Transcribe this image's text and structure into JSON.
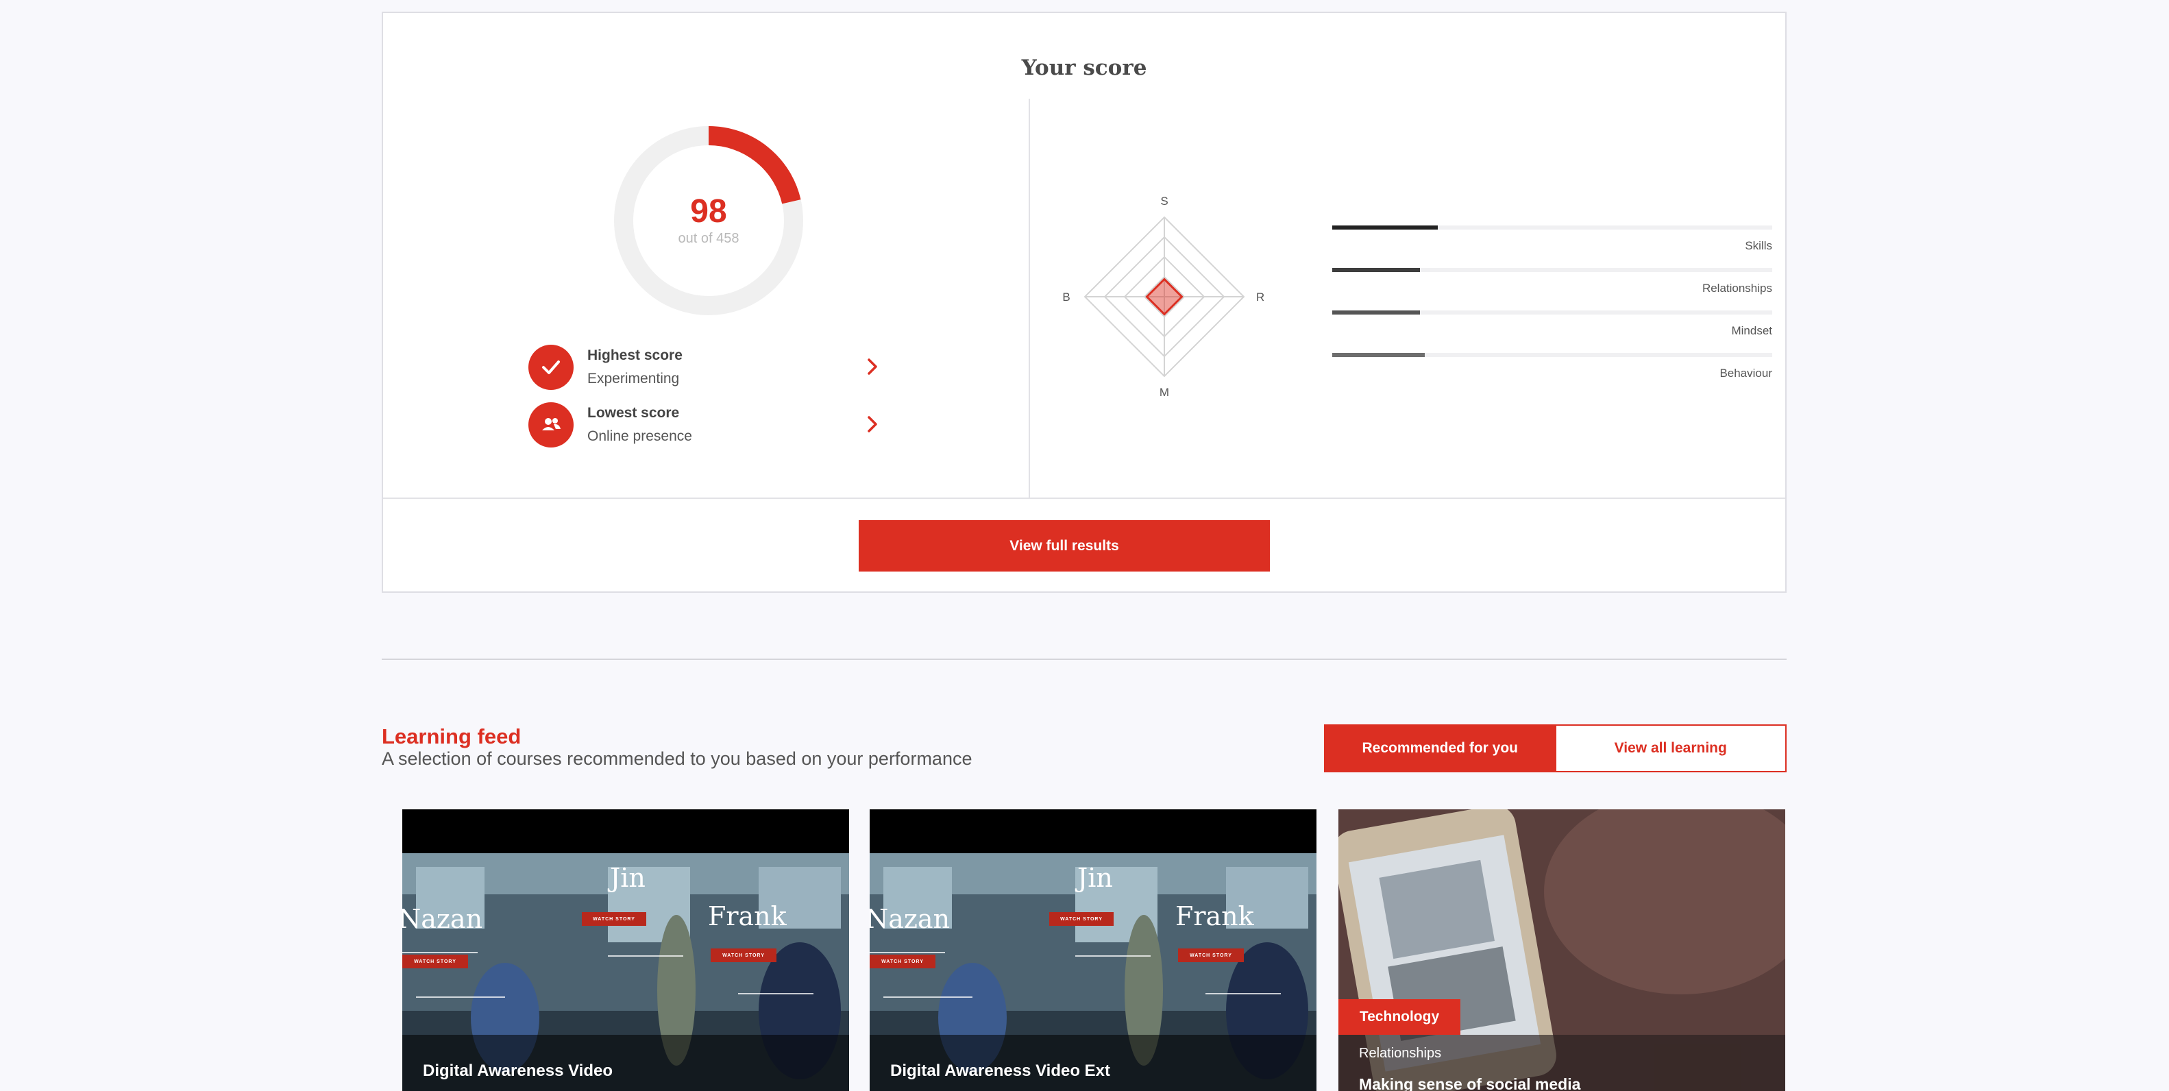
{
  "score": {
    "title": "Your score",
    "value": "98",
    "out_of": "out of 458",
    "fraction": 0.214,
    "highest": {
      "label": "Highest score",
      "value": "Experimenting",
      "icon": "check-icon"
    },
    "lowest": {
      "label": "Lowest score",
      "value": "Online presence",
      "icon": "people-icon"
    },
    "radar_axes": {
      "top": "S",
      "right": "R",
      "bottom": "M",
      "left": "B"
    },
    "radar_values": {
      "S": 0.22,
      "R": 0.22,
      "M": 0.22,
      "B": 0.22
    },
    "bars": [
      {
        "label": "Skills",
        "fraction": 0.24,
        "color": "#222222"
      },
      {
        "label": "Relationships",
        "fraction": 0.2,
        "color": "#3d3d3d"
      },
      {
        "label": "Mindset",
        "fraction": 0.2,
        "color": "#555555"
      },
      {
        "label": "Behaviour",
        "fraction": 0.21,
        "color": "#6e6e6e"
      }
    ],
    "view_full_label": "View full results"
  },
  "feed": {
    "title": "Learning feed",
    "subtitle": "A selection of courses recommended to you based on your performance",
    "tabs": [
      "Recommended for you",
      "View all learning"
    ],
    "cards": [
      {
        "title": "Digital Awareness Video",
        "names": [
          "Nazan",
          "Jin",
          "Frank"
        ],
        "tag": "WATCH STORY"
      },
      {
        "title": "Digital Awareness Video Ext",
        "names": [
          "Nazan",
          "Jin",
          "Frank"
        ],
        "tag": "WATCH STORY"
      },
      {
        "badge": "Technology",
        "category": "Relationships",
        "title": "Making sense of social media"
      }
    ]
  },
  "colors": {
    "accent": "#dc2f22",
    "background": "#f8f8fc"
  }
}
